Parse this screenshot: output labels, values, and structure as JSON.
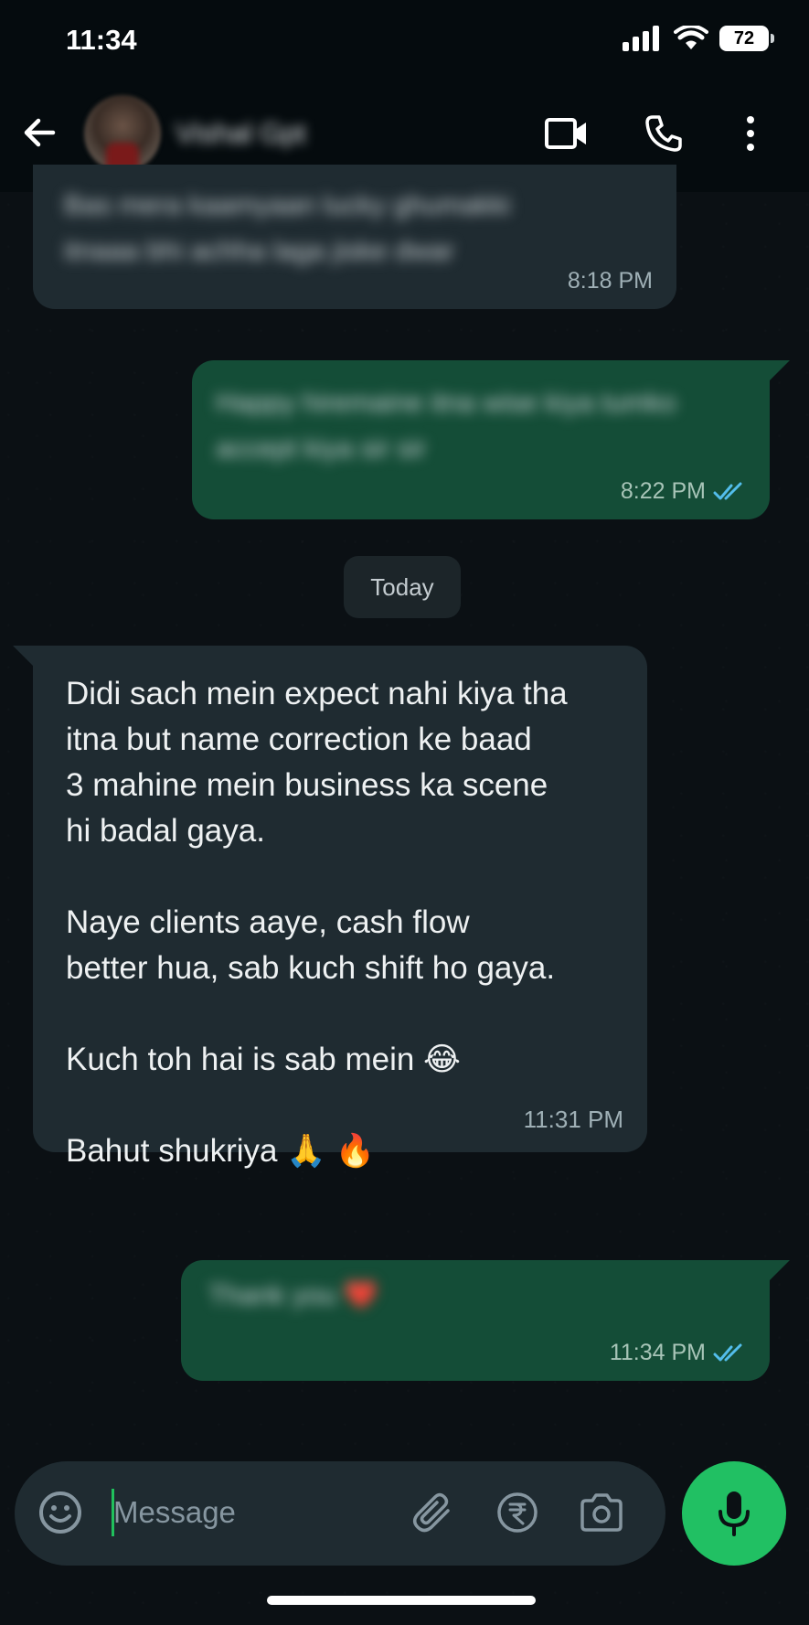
{
  "status_bar": {
    "time": "11:34",
    "battery": "72"
  },
  "header": {
    "contact_name": "Vishal Gpt"
  },
  "chat": {
    "messages": [
      {
        "direction": "incoming",
        "text": "Bas mera kaamyaan lucky ghumakki itnaaa bhi achha laga jiske dwar",
        "time": "8:18 PM",
        "blurred": true
      },
      {
        "direction": "outgoing",
        "text": "Happy hiremaine itna wise kiya tumko accept kiya sir sir",
        "time": "8:22 PM",
        "blurred": true,
        "status": "read"
      },
      {
        "direction": "date",
        "text": "Today"
      },
      {
        "direction": "incoming",
        "text": "Didi sach mein expect nahi kiya tha\nitna but name correction ke baad\n3 mahine mein business ka scene\nhi badal gaya.\n\nNaye clients aaye, cash flow\nbetter hua, sab kuch shift ho gaya.\n\nKuch toh hai is sab mein 😂\n\nBahut shukriya 🙏 🔥",
        "time": "11:31 PM",
        "blurred": false
      },
      {
        "direction": "outgoing",
        "text": "Thank you ❤️",
        "time": "11:34 PM",
        "blurred": true,
        "status": "read"
      }
    ]
  },
  "composer": {
    "placeholder": "Message"
  },
  "colors": {
    "accent": "#21c063",
    "outgoing_bubble": "#144d37",
    "incoming_bubble": "#1f2b31",
    "tick_read": "#53bdeb"
  }
}
